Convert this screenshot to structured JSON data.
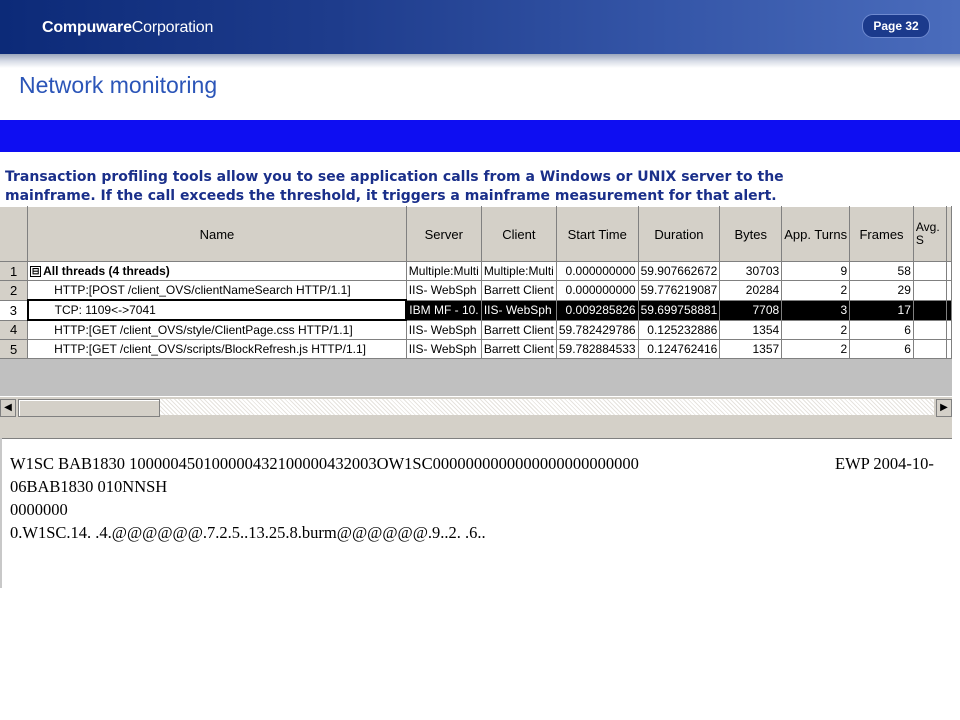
{
  "header": {
    "brand_bold": "Compuware",
    "brand_rest": "Corporation",
    "page_label": "Page 32"
  },
  "slide": {
    "title": "Network monitoring",
    "description_line1": "Transaction profiling tools allow you to see application calls from a Windows or UNIX server to the",
    "description_line2": "mainframe. If the call exceeds the threshold, it triggers a mainframe measurement for that alert."
  },
  "grid": {
    "columns": [
      "Name",
      "Server",
      "Client",
      "Start Time",
      "Duration",
      "Bytes",
      "App. Turns",
      "Frames",
      "Avg. S"
    ],
    "rows": [
      {
        "num": "1",
        "name": "All threads (4 threads)",
        "server": "Multiple:Multi",
        "client": "Multiple:Multi",
        "start": "0.000000000",
        "duration": "59.907662672",
        "bytes": "30703",
        "turns": "9",
        "frames": "58"
      },
      {
        "num": "2",
        "name": "HTTP:[POST /client_OVS/clientNameSearch HTTP/1.1]",
        "server": "IIS- WebSph",
        "client": "Barrett Client",
        "start": "0.000000000",
        "duration": "59.776219087",
        "bytes": "20284",
        "turns": "2",
        "frames": "29"
      },
      {
        "num": "3",
        "name": "TCP: 1109<->7041",
        "server": "IBM MF - 10.",
        "client": "IIS- WebSph",
        "start": "0.009285826",
        "duration": "59.699758881",
        "bytes": "7708",
        "turns": "3",
        "frames": "17"
      },
      {
        "num": "4",
        "name": "HTTP:[GET /client_OVS/style/ClientPage.css HTTP/1.1]",
        "server": "IIS- WebSph",
        "client": "Barrett Client",
        "start": "59.782429786",
        "duration": "0.125232886",
        "bytes": "1354",
        "turns": "2",
        "frames": "6"
      },
      {
        "num": "5",
        "name": "HTTP:[GET /client_OVS/scripts/BlockRefresh.js HTTP/1.1]",
        "server": "IIS- WebSph",
        "client": "Barrett Client",
        "start": "59.782884533",
        "duration": "0.124762416",
        "bytes": "1357",
        "turns": "2",
        "frames": "6"
      }
    ],
    "expander_glyph": "⊟",
    "scroll_left": "◀",
    "scroll_right": "▶"
  },
  "raw_data": {
    "line1": "W1SC BAB1830 100000450100000432100000432003OW1SC0000000000000000000000000",
    "line1_right": "EWP 2004-10-",
    "line2": "06BAB1830 010NNSH",
    "line3": "0000000",
    "line4": "0.W1SC.14. .4.@@@@@@.7.2.5..13.25.8.burm@@@@@@.9..2. .6.."
  }
}
